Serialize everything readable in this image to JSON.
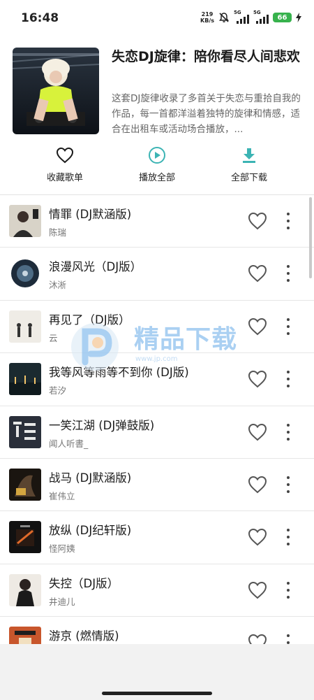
{
  "status_bar": {
    "time": "16:48",
    "net_speed_value": "219",
    "net_speed_unit": "KB/s",
    "signal1_label": "5G",
    "signal2_label": "5G",
    "battery": "66",
    "icons": [
      "mute-icon",
      "signal-icon",
      "battery-icon",
      "charging-icon"
    ]
  },
  "playlist": {
    "title": "失恋DJ旋律：陪你看尽人间悲欢",
    "description": "这套DJ旋律收录了多首关于失恋与重拾自我的作品，每一首都洋溢着独特的旋律和情感，适合在出租车或活动场合播放，..."
  },
  "actions": {
    "favorite": "收藏歌单",
    "play_all": "播放全部",
    "download_all": "全部下载"
  },
  "songs": [
    {
      "title": "情罪 (DJ默涵版)",
      "artist": "陈瑞"
    },
    {
      "title": "浪漫风光（DJ版）",
      "artist": "沐淅"
    },
    {
      "title": "再见了（DJ版）",
      "artist": "云"
    },
    {
      "title": "我等风等雨等不到你 (DJ版)",
      "artist": "若汐"
    },
    {
      "title": "一笑江湖 (DJ弹鼓版)",
      "artist": "闻人听書_"
    },
    {
      "title": "战马 (DJ默涵版)",
      "artist": "崔伟立"
    },
    {
      "title": "放纵 (DJ纪轩版)",
      "artist": "怪阿姨"
    },
    {
      "title": "失控（DJ版）",
      "artist": "井迪儿"
    },
    {
      "title": "游京 (燃情版)",
      "artist": ""
    }
  ],
  "watermark": {
    "text": "精品下载",
    "url": "www.jp.com"
  },
  "colors": {
    "accent": "#3cb4b4",
    "battery": "#37b24d"
  }
}
